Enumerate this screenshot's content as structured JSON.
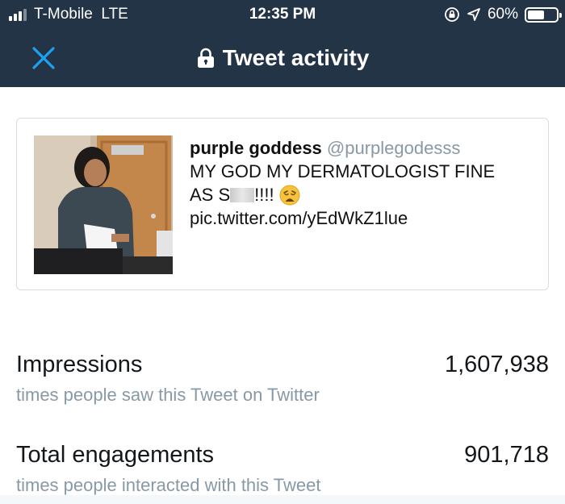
{
  "status_bar": {
    "carrier": "T-Mobile",
    "network": "LTE",
    "time": "12:35 PM",
    "battery_text": "60%",
    "battery_level": 0.6,
    "icons": [
      "signal-icon",
      "orientation-lock-icon",
      "location-arrow-icon",
      "battery-icon"
    ]
  },
  "nav": {
    "title": "Tweet activity",
    "close_icon": "close-x-icon",
    "lock_icon": "lock-icon"
  },
  "tweet": {
    "author_name": "purple goddess",
    "author_handle": "@purplegodesss",
    "text_line1": "MY GOD MY DERMATOLOGIST FINE",
    "text_line2_prefix": "AS S",
    "text_line2_suffix": "!!!!",
    "emoji": "weary-face",
    "link": "pic.twitter.com/yEdWkZ1lue"
  },
  "metrics": [
    {
      "label": "Impressions",
      "description": "times people saw this Tweet on Twitter",
      "value": "1,607,938"
    },
    {
      "label": "Total engagements",
      "description": "times people interacted with this Tweet",
      "value": "901,718"
    }
  ],
  "colors": {
    "header_bg": "#243447",
    "accent_blue": "#1da1f2",
    "muted_text": "#8899a6"
  }
}
